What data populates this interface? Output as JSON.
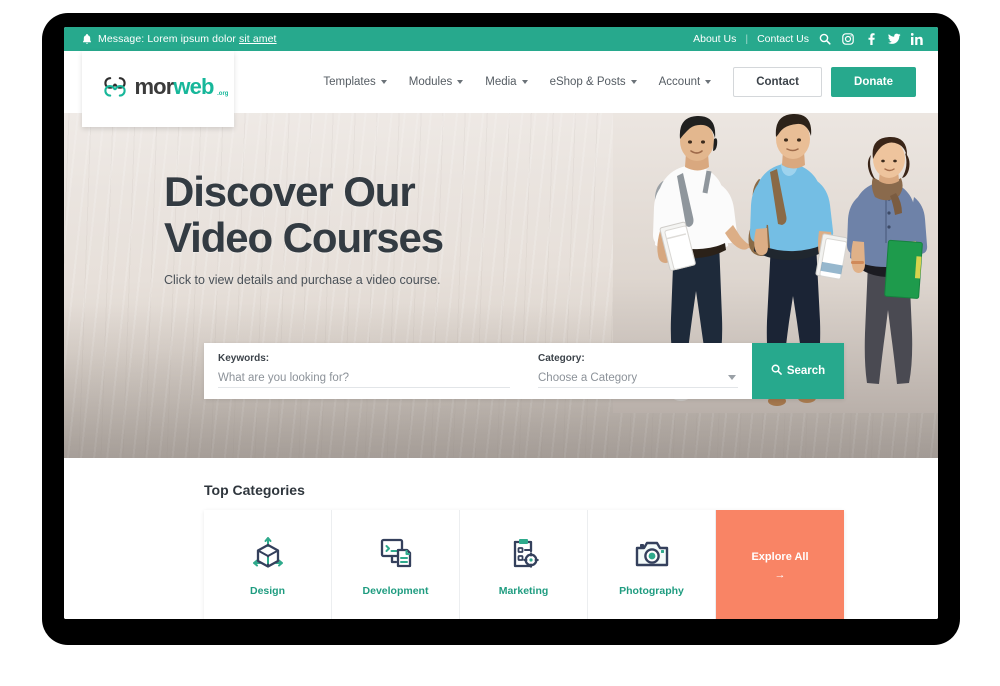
{
  "topbar": {
    "bell_icon": "bell-icon",
    "message_prefix": "Message: Lorem ipsum dolor ",
    "message_link": "sit amet",
    "about_us": "About Us",
    "separator": "|",
    "contact_us": "Contact Us",
    "icons": [
      "search-icon",
      "instagram-icon",
      "facebook-icon",
      "twitter-icon",
      "linkedin-icon"
    ],
    "bg_color": "#27a98d"
  },
  "nav": {
    "logo": {
      "mark": "morweb-infinity-logo",
      "word_dark": "mor",
      "word_teal": "web",
      "tld": ".org"
    },
    "items": [
      {
        "label": "Templates",
        "has_caret": true
      },
      {
        "label": "Modules",
        "has_caret": true
      },
      {
        "label": "Media",
        "has_caret": true
      },
      {
        "label": "eShop & Posts",
        "has_caret": true
      },
      {
        "label": "Account",
        "has_caret": true
      }
    ],
    "contact_button": "Contact",
    "donate_button": "Donate"
  },
  "hero": {
    "title_line1": "Discover Our",
    "title_line2": "Video Courses",
    "subtitle": "Click to view details and purchase a video course.",
    "image_alt": "three-students-walking-photo"
  },
  "search": {
    "keywords_label": "Keywords:",
    "keywords_placeholder": "What are you looking for?",
    "category_label": "Category:",
    "category_value": "Choose a Category",
    "search_button": "Search",
    "search_icon": "search-icon",
    "button_color": "#27a98d"
  },
  "categories": {
    "title": "Top Categories",
    "cards": [
      {
        "label": "Design",
        "icon": "cube-3d-icon"
      },
      {
        "label": "Development",
        "icon": "code-window-icon"
      },
      {
        "label": "Marketing",
        "icon": "clipboard-target-icon"
      },
      {
        "label": "Photography",
        "icon": "camera-icon"
      }
    ],
    "explore": {
      "label": "Explore All",
      "arrow": "→",
      "bg_color": "#f98465"
    }
  },
  "theme": {
    "teal": "#27a98d",
    "teal_text": "#1f9c80",
    "coral": "#f98465",
    "navy": "#34405c",
    "heading": "#333b42"
  }
}
